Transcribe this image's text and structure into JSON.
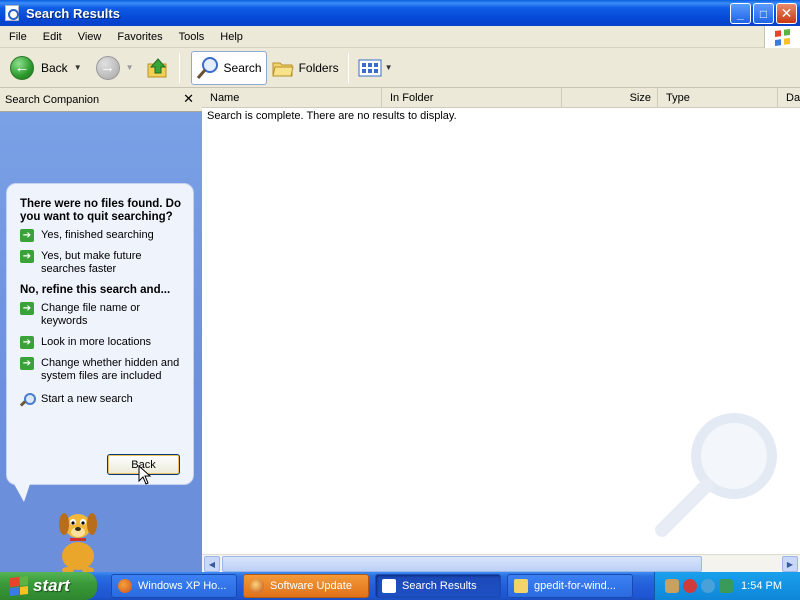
{
  "window": {
    "title": "Search Results",
    "controls": [
      "_",
      "□",
      "✕"
    ]
  },
  "menu": [
    "File",
    "Edit",
    "View",
    "Favorites",
    "Tools",
    "Help"
  ],
  "toolbar": {
    "back_label": "Back",
    "search_label": "Search",
    "folders_label": "Folders"
  },
  "left_pane": {
    "header": "Search Companion",
    "close": "✕",
    "question": "There were no files found. Do you want to quit searching?",
    "quit_options": [
      "Yes, finished searching",
      "Yes, but make future searches faster"
    ],
    "refine_heading": "No, refine this search and...",
    "refine_options": [
      "Change file name or keywords",
      "Look in more locations",
      "Change whether hidden and system files are included"
    ],
    "new_search": "Start a new search",
    "back_button": "Back"
  },
  "results": {
    "columns": [
      "Name",
      "In Folder",
      "Size",
      "Type",
      "Da"
    ],
    "message": "Search is complete. There are no results to display."
  },
  "taskbar": {
    "start": "start",
    "tasks": [
      "Windows XP Ho...",
      "Software Update",
      "Search Results",
      "gpedit-for-wind..."
    ],
    "clock": "1:54 PM"
  },
  "colors": {
    "titlebar": "#0549d6",
    "left_pane": "#6d8fdd",
    "taskbar": "#245edb",
    "start": "#3a9a3a"
  }
}
